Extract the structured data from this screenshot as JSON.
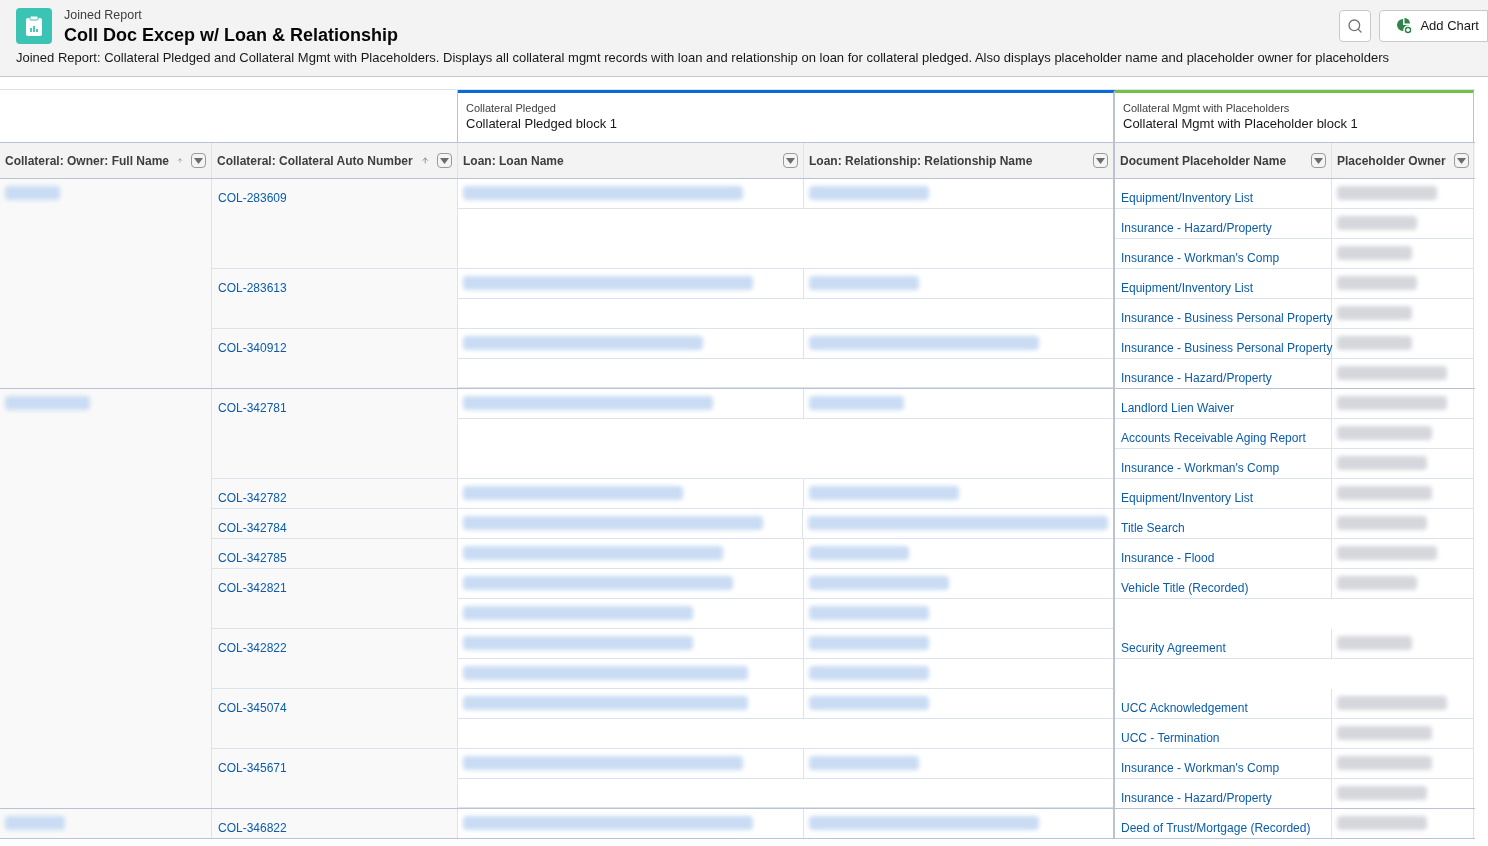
{
  "header": {
    "eyebrow": "Joined Report",
    "title": "Coll Doc Excep w/ Loan & Relationship",
    "description": "Joined Report: Collateral Pledged and Collateral Mgmt with Placeholders. Displays all collateral mgmt records with loan and relationship on loan for collateral pledged. Also displays placeholder name and placeholder owner for placeholders",
    "actions": [
      {
        "kind": "search"
      },
      {
        "kind": "add-chart",
        "label": "Add Chart"
      }
    ]
  },
  "blocks": [
    {
      "subtitle": "Collateral Pledged",
      "title": "Collateral Pledged block 1",
      "color": "#0b6bd6"
    },
    {
      "subtitle": "Collateral Mgmt with Placeholders",
      "title": "Collateral Mgmt with Placeholder block 1",
      "color": "#73c04a"
    }
  ],
  "columns": [
    {
      "label": "Collateral: Owner: Full Name",
      "sorted": true
    },
    {
      "label": "Collateral: Collateral Auto Number",
      "sorted": true
    },
    {
      "label": "Loan: Loan Name",
      "sorted": false
    },
    {
      "label": "Loan: Relationship: Relationship Name",
      "sorted": false
    },
    {
      "label": "Document Placeholder Name",
      "sorted": false
    },
    {
      "label": "Placeholder Owner",
      "sorted": false
    }
  ],
  "groups": [
    {
      "owner": {
        "kind": "blurred"
      },
      "collaterals": [
        {
          "number": "COL-283609",
          "loans": [
            {
              "kind": "blurred"
            }
          ],
          "placeholders": [
            {
              "name": "Equipment/Inventory List",
              "owner": {
                "kind": "blurred"
              }
            },
            {
              "name": "Insurance - Hazard/Property",
              "owner": {
                "kind": "blurred"
              }
            },
            {
              "name": "Insurance - Workman's Comp",
              "owner": {
                "kind": "blurred"
              }
            }
          ]
        },
        {
          "number": "COL-283613",
          "loans": [
            {
              "kind": "blurred"
            }
          ],
          "placeholders": [
            {
              "name": "Equipment/Inventory List",
              "owner": {
                "kind": "blurred"
              }
            },
            {
              "name": "Insurance - Business Personal Property",
              "owner": {
                "kind": "blurred"
              }
            }
          ]
        },
        {
          "number": "COL-340912",
          "loans": [
            {
              "kind": "blurred"
            }
          ],
          "placeholders": [
            {
              "name": "Insurance - Business Personal Property",
              "owner": {
                "kind": "blurred"
              }
            },
            {
              "name": "Insurance - Hazard/Property",
              "owner": {
                "kind": "blurred"
              }
            }
          ]
        }
      ]
    },
    {
      "owner": {
        "kind": "blurred"
      },
      "collaterals": [
        {
          "number": "COL-342781",
          "loans": [
            {
              "kind": "blurred"
            }
          ],
          "placeholders": [
            {
              "name": "Landlord Lien Waiver",
              "owner": {
                "kind": "blurred"
              }
            },
            {
              "name": "Accounts Receivable Aging Report",
              "owner": {
                "kind": "blurred"
              }
            },
            {
              "name": "Insurance - Workman's Comp",
              "owner": {
                "kind": "blurred"
              }
            }
          ]
        },
        {
          "number": "COL-342782",
          "loans": [
            {
              "kind": "blurred"
            }
          ],
          "placeholders": [
            {
              "name": "Equipment/Inventory List",
              "owner": {
                "kind": "blurred"
              }
            }
          ]
        },
        {
          "number": "COL-342784",
          "loans": [
            {
              "kind": "blurred"
            }
          ],
          "placeholders": [
            {
              "name": "Title Search",
              "owner": {
                "kind": "blurred"
              }
            }
          ]
        },
        {
          "number": "COL-342785",
          "loans": [
            {
              "kind": "blurred"
            }
          ],
          "placeholders": [
            {
              "name": "Insurance - Flood",
              "owner": {
                "kind": "blurred"
              }
            }
          ]
        },
        {
          "number": "COL-342821",
          "loans": [
            {
              "kind": "blurred"
            },
            {
              "kind": "blurred"
            }
          ],
          "placeholders": [
            {
              "name": "Vehicle Title (Recorded)",
              "owner": {
                "kind": "blurred"
              }
            }
          ]
        },
        {
          "number": "COL-342822",
          "loans": [
            {
              "kind": "blurred"
            },
            {
              "kind": "blurred"
            }
          ],
          "placeholders": [
            {
              "name": "Security Agreement",
              "owner": {
                "kind": "blurred"
              }
            }
          ]
        },
        {
          "number": "COL-345074",
          "loans": [
            {
              "kind": "blurred"
            }
          ],
          "placeholders": [
            {
              "name": "UCC Acknowledgement",
              "owner": {
                "kind": "blurred"
              }
            },
            {
              "name": "UCC - Termination",
              "owner": {
                "kind": "blurred"
              }
            }
          ]
        },
        {
          "number": "COL-345671",
          "loans": [
            {
              "kind": "blurred"
            }
          ],
          "placeholders": [
            {
              "name": "Insurance - Workman's Comp",
              "owner": {
                "kind": "blurred"
              }
            },
            {
              "name": "Insurance - Hazard/Property",
              "owner": {
                "kind": "blurred"
              }
            }
          ]
        }
      ]
    },
    {
      "owner": {
        "kind": "blurred"
      },
      "collaterals": [
        {
          "number": "COL-346822",
          "loans": [
            {
              "kind": "blurred"
            }
          ],
          "placeholders": [
            {
              "name": "Deed of Trust/Mortgage (Recorded)",
              "owner": {
                "kind": "blurred"
              }
            }
          ]
        }
      ]
    }
  ]
}
